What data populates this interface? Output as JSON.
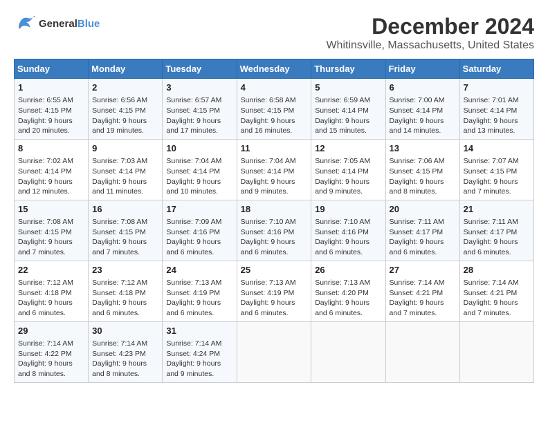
{
  "header": {
    "logo_line1": "General",
    "logo_line2": "Blue",
    "month_title": "December 2024",
    "location": "Whitinsville, Massachusetts, United States"
  },
  "weekdays": [
    "Sunday",
    "Monday",
    "Tuesday",
    "Wednesday",
    "Thursday",
    "Friday",
    "Saturday"
  ],
  "weeks": [
    [
      {
        "day": "1",
        "info": "Sunrise: 6:55 AM\nSunset: 4:15 PM\nDaylight: 9 hours and 20 minutes."
      },
      {
        "day": "2",
        "info": "Sunrise: 6:56 AM\nSunset: 4:15 PM\nDaylight: 9 hours and 19 minutes."
      },
      {
        "day": "3",
        "info": "Sunrise: 6:57 AM\nSunset: 4:15 PM\nDaylight: 9 hours and 17 minutes."
      },
      {
        "day": "4",
        "info": "Sunrise: 6:58 AM\nSunset: 4:15 PM\nDaylight: 9 hours and 16 minutes."
      },
      {
        "day": "5",
        "info": "Sunrise: 6:59 AM\nSunset: 4:14 PM\nDaylight: 9 hours and 15 minutes."
      },
      {
        "day": "6",
        "info": "Sunrise: 7:00 AM\nSunset: 4:14 PM\nDaylight: 9 hours and 14 minutes."
      },
      {
        "day": "7",
        "info": "Sunrise: 7:01 AM\nSunset: 4:14 PM\nDaylight: 9 hours and 13 minutes."
      }
    ],
    [
      {
        "day": "8",
        "info": "Sunrise: 7:02 AM\nSunset: 4:14 PM\nDaylight: 9 hours and 12 minutes."
      },
      {
        "day": "9",
        "info": "Sunrise: 7:03 AM\nSunset: 4:14 PM\nDaylight: 9 hours and 11 minutes."
      },
      {
        "day": "10",
        "info": "Sunrise: 7:04 AM\nSunset: 4:14 PM\nDaylight: 9 hours and 10 minutes."
      },
      {
        "day": "11",
        "info": "Sunrise: 7:04 AM\nSunset: 4:14 PM\nDaylight: 9 hours and 9 minutes."
      },
      {
        "day": "12",
        "info": "Sunrise: 7:05 AM\nSunset: 4:14 PM\nDaylight: 9 hours and 9 minutes."
      },
      {
        "day": "13",
        "info": "Sunrise: 7:06 AM\nSunset: 4:15 PM\nDaylight: 9 hours and 8 minutes."
      },
      {
        "day": "14",
        "info": "Sunrise: 7:07 AM\nSunset: 4:15 PM\nDaylight: 9 hours and 7 minutes."
      }
    ],
    [
      {
        "day": "15",
        "info": "Sunrise: 7:08 AM\nSunset: 4:15 PM\nDaylight: 9 hours and 7 minutes."
      },
      {
        "day": "16",
        "info": "Sunrise: 7:08 AM\nSunset: 4:15 PM\nDaylight: 9 hours and 7 minutes."
      },
      {
        "day": "17",
        "info": "Sunrise: 7:09 AM\nSunset: 4:16 PM\nDaylight: 9 hours and 6 minutes."
      },
      {
        "day": "18",
        "info": "Sunrise: 7:10 AM\nSunset: 4:16 PM\nDaylight: 9 hours and 6 minutes."
      },
      {
        "day": "19",
        "info": "Sunrise: 7:10 AM\nSunset: 4:16 PM\nDaylight: 9 hours and 6 minutes."
      },
      {
        "day": "20",
        "info": "Sunrise: 7:11 AM\nSunset: 4:17 PM\nDaylight: 9 hours and 6 minutes."
      },
      {
        "day": "21",
        "info": "Sunrise: 7:11 AM\nSunset: 4:17 PM\nDaylight: 9 hours and 6 minutes."
      }
    ],
    [
      {
        "day": "22",
        "info": "Sunrise: 7:12 AM\nSunset: 4:18 PM\nDaylight: 9 hours and 6 minutes."
      },
      {
        "day": "23",
        "info": "Sunrise: 7:12 AM\nSunset: 4:18 PM\nDaylight: 9 hours and 6 minutes."
      },
      {
        "day": "24",
        "info": "Sunrise: 7:13 AM\nSunset: 4:19 PM\nDaylight: 9 hours and 6 minutes."
      },
      {
        "day": "25",
        "info": "Sunrise: 7:13 AM\nSunset: 4:19 PM\nDaylight: 9 hours and 6 minutes."
      },
      {
        "day": "26",
        "info": "Sunrise: 7:13 AM\nSunset: 4:20 PM\nDaylight: 9 hours and 6 minutes."
      },
      {
        "day": "27",
        "info": "Sunrise: 7:14 AM\nSunset: 4:21 PM\nDaylight: 9 hours and 7 minutes."
      },
      {
        "day": "28",
        "info": "Sunrise: 7:14 AM\nSunset: 4:21 PM\nDaylight: 9 hours and 7 minutes."
      }
    ],
    [
      {
        "day": "29",
        "info": "Sunrise: 7:14 AM\nSunset: 4:22 PM\nDaylight: 9 hours and 8 minutes."
      },
      {
        "day": "30",
        "info": "Sunrise: 7:14 AM\nSunset: 4:23 PM\nDaylight: 9 hours and 8 minutes."
      },
      {
        "day": "31",
        "info": "Sunrise: 7:14 AM\nSunset: 4:24 PM\nDaylight: 9 hours and 9 minutes."
      },
      {
        "day": "",
        "info": ""
      },
      {
        "day": "",
        "info": ""
      },
      {
        "day": "",
        "info": ""
      },
      {
        "day": "",
        "info": ""
      }
    ]
  ]
}
